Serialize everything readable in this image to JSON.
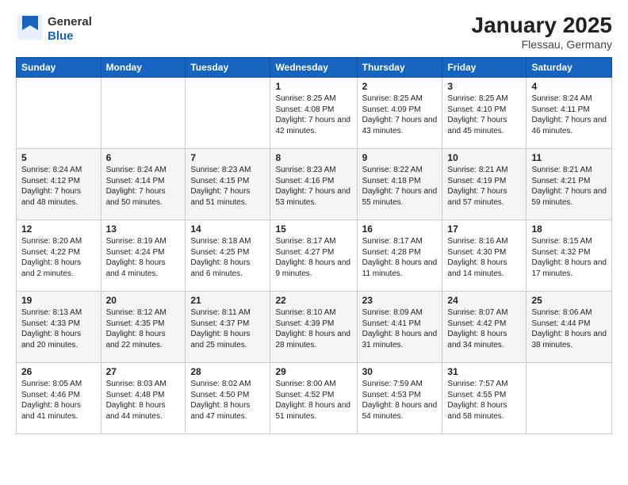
{
  "logo": {
    "general": "General",
    "blue": "Blue"
  },
  "title": "January 2025",
  "location": "Flessau, Germany",
  "weekdays": [
    "Sunday",
    "Monday",
    "Tuesday",
    "Wednesday",
    "Thursday",
    "Friday",
    "Saturday"
  ],
  "weeks": [
    [
      {
        "day": "",
        "sunrise": "",
        "sunset": "",
        "daylight": ""
      },
      {
        "day": "",
        "sunrise": "",
        "sunset": "",
        "daylight": ""
      },
      {
        "day": "",
        "sunrise": "",
        "sunset": "",
        "daylight": ""
      },
      {
        "day": "1",
        "sunrise": "Sunrise: 8:25 AM",
        "sunset": "Sunset: 4:08 PM",
        "daylight": "Daylight: 7 hours and 42 minutes."
      },
      {
        "day": "2",
        "sunrise": "Sunrise: 8:25 AM",
        "sunset": "Sunset: 4:09 PM",
        "daylight": "Daylight: 7 hours and 43 minutes."
      },
      {
        "day": "3",
        "sunrise": "Sunrise: 8:25 AM",
        "sunset": "Sunset: 4:10 PM",
        "daylight": "Daylight: 7 hours and 45 minutes."
      },
      {
        "day": "4",
        "sunrise": "Sunrise: 8:24 AM",
        "sunset": "Sunset: 4:11 PM",
        "daylight": "Daylight: 7 hours and 46 minutes."
      }
    ],
    [
      {
        "day": "5",
        "sunrise": "Sunrise: 8:24 AM",
        "sunset": "Sunset: 4:12 PM",
        "daylight": "Daylight: 7 hours and 48 minutes."
      },
      {
        "day": "6",
        "sunrise": "Sunrise: 8:24 AM",
        "sunset": "Sunset: 4:14 PM",
        "daylight": "Daylight: 7 hours and 50 minutes."
      },
      {
        "day": "7",
        "sunrise": "Sunrise: 8:23 AM",
        "sunset": "Sunset: 4:15 PM",
        "daylight": "Daylight: 7 hours and 51 minutes."
      },
      {
        "day": "8",
        "sunrise": "Sunrise: 8:23 AM",
        "sunset": "Sunset: 4:16 PM",
        "daylight": "Daylight: 7 hours and 53 minutes."
      },
      {
        "day": "9",
        "sunrise": "Sunrise: 8:22 AM",
        "sunset": "Sunset: 4:18 PM",
        "daylight": "Daylight: 7 hours and 55 minutes."
      },
      {
        "day": "10",
        "sunrise": "Sunrise: 8:21 AM",
        "sunset": "Sunset: 4:19 PM",
        "daylight": "Daylight: 7 hours and 57 minutes."
      },
      {
        "day": "11",
        "sunrise": "Sunrise: 8:21 AM",
        "sunset": "Sunset: 4:21 PM",
        "daylight": "Daylight: 7 hours and 59 minutes."
      }
    ],
    [
      {
        "day": "12",
        "sunrise": "Sunrise: 8:20 AM",
        "sunset": "Sunset: 4:22 PM",
        "daylight": "Daylight: 8 hours and 2 minutes."
      },
      {
        "day": "13",
        "sunrise": "Sunrise: 8:19 AM",
        "sunset": "Sunset: 4:24 PM",
        "daylight": "Daylight: 8 hours and 4 minutes."
      },
      {
        "day": "14",
        "sunrise": "Sunrise: 8:18 AM",
        "sunset": "Sunset: 4:25 PM",
        "daylight": "Daylight: 8 hours and 6 minutes."
      },
      {
        "day": "15",
        "sunrise": "Sunrise: 8:17 AM",
        "sunset": "Sunset: 4:27 PM",
        "daylight": "Daylight: 8 hours and 9 minutes."
      },
      {
        "day": "16",
        "sunrise": "Sunrise: 8:17 AM",
        "sunset": "Sunset: 4:28 PM",
        "daylight": "Daylight: 8 hours and 11 minutes."
      },
      {
        "day": "17",
        "sunrise": "Sunrise: 8:16 AM",
        "sunset": "Sunset: 4:30 PM",
        "daylight": "Daylight: 8 hours and 14 minutes."
      },
      {
        "day": "18",
        "sunrise": "Sunrise: 8:15 AM",
        "sunset": "Sunset: 4:32 PM",
        "daylight": "Daylight: 8 hours and 17 minutes."
      }
    ],
    [
      {
        "day": "19",
        "sunrise": "Sunrise: 8:13 AM",
        "sunset": "Sunset: 4:33 PM",
        "daylight": "Daylight: 8 hours and 20 minutes."
      },
      {
        "day": "20",
        "sunrise": "Sunrise: 8:12 AM",
        "sunset": "Sunset: 4:35 PM",
        "daylight": "Daylight: 8 hours and 22 minutes."
      },
      {
        "day": "21",
        "sunrise": "Sunrise: 8:11 AM",
        "sunset": "Sunset: 4:37 PM",
        "daylight": "Daylight: 8 hours and 25 minutes."
      },
      {
        "day": "22",
        "sunrise": "Sunrise: 8:10 AM",
        "sunset": "Sunset: 4:39 PM",
        "daylight": "Daylight: 8 hours and 28 minutes."
      },
      {
        "day": "23",
        "sunrise": "Sunrise: 8:09 AM",
        "sunset": "Sunset: 4:41 PM",
        "daylight": "Daylight: 8 hours and 31 minutes."
      },
      {
        "day": "24",
        "sunrise": "Sunrise: 8:07 AM",
        "sunset": "Sunset: 4:42 PM",
        "daylight": "Daylight: 8 hours and 34 minutes."
      },
      {
        "day": "25",
        "sunrise": "Sunrise: 8:06 AM",
        "sunset": "Sunset: 4:44 PM",
        "daylight": "Daylight: 8 hours and 38 minutes."
      }
    ],
    [
      {
        "day": "26",
        "sunrise": "Sunrise: 8:05 AM",
        "sunset": "Sunset: 4:46 PM",
        "daylight": "Daylight: 8 hours and 41 minutes."
      },
      {
        "day": "27",
        "sunrise": "Sunrise: 8:03 AM",
        "sunset": "Sunset: 4:48 PM",
        "daylight": "Daylight: 8 hours and 44 minutes."
      },
      {
        "day": "28",
        "sunrise": "Sunrise: 8:02 AM",
        "sunset": "Sunset: 4:50 PM",
        "daylight": "Daylight: 8 hours and 47 minutes."
      },
      {
        "day": "29",
        "sunrise": "Sunrise: 8:00 AM",
        "sunset": "Sunset: 4:52 PM",
        "daylight": "Daylight: 8 hours and 51 minutes."
      },
      {
        "day": "30",
        "sunrise": "Sunrise: 7:59 AM",
        "sunset": "Sunset: 4:53 PM",
        "daylight": "Daylight: 8 hours and 54 minutes."
      },
      {
        "day": "31",
        "sunrise": "Sunrise: 7:57 AM",
        "sunset": "Sunset: 4:55 PM",
        "daylight": "Daylight: 8 hours and 58 minutes."
      },
      {
        "day": "",
        "sunrise": "",
        "sunset": "",
        "daylight": ""
      }
    ]
  ]
}
